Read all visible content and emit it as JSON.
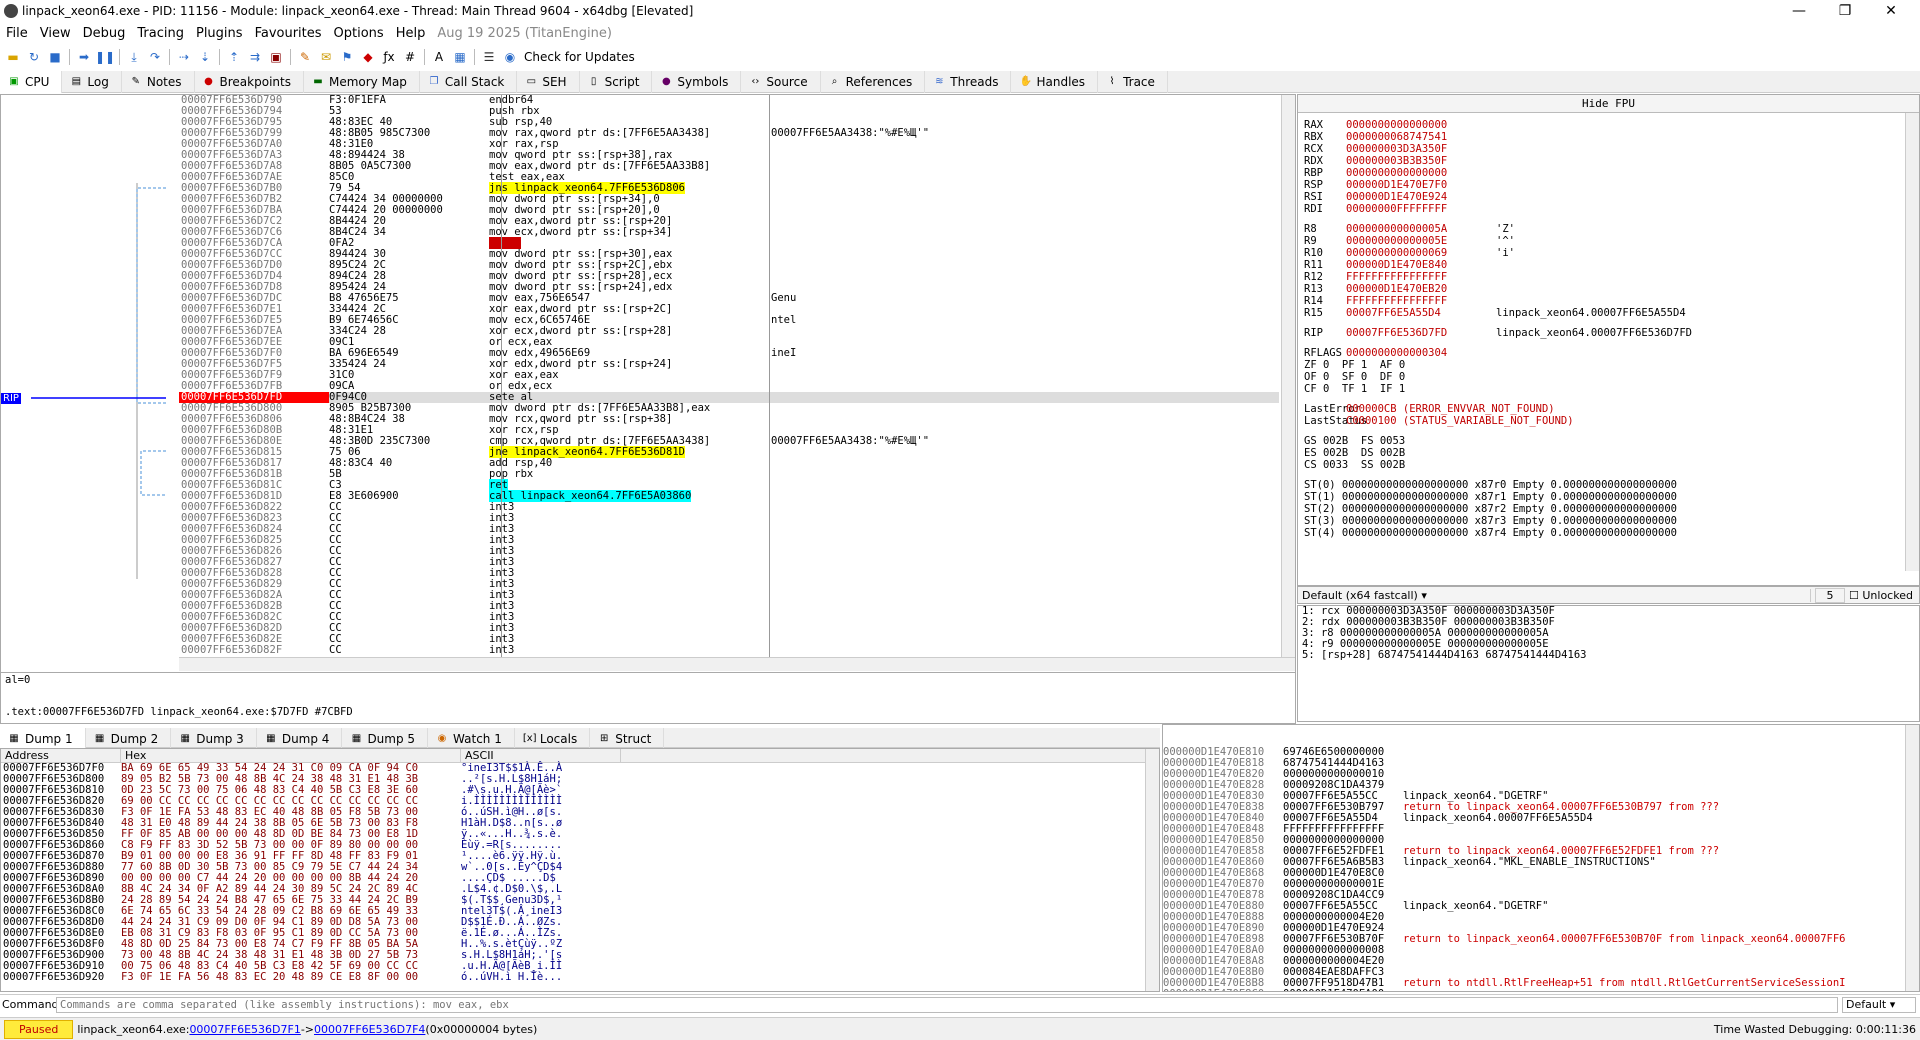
{
  "window": {
    "title": "linpack_xeon64.exe - PID: 11156 - Module: linpack_xeon64.exe - Thread: Main Thread 9604 - x64dbg [Elevated]",
    "minimize": "—",
    "maximize": "❐",
    "close": "✕"
  },
  "menu": {
    "items": [
      "File",
      "View",
      "Debug",
      "Tracing",
      "Plugins",
      "Favourites",
      "Options",
      "Help"
    ],
    "build_info": "Aug 19 2025 (TitanEngine)"
  },
  "toolbar": {
    "check_updates": "Check for Updates",
    "icons": [
      "open-icon",
      "restart-icon",
      "close-icon",
      "run-icon",
      "pause-icon",
      "step-into-icon",
      "step-over-icon",
      "trace-into-icon",
      "trace-over-icon",
      "execute-till-return-icon",
      "run-to-user-code-icon",
      "scylla-icon",
      "patch-icon",
      "comment-icon",
      "label-icon",
      "bookmark-icon",
      "function-icon",
      "hash-icon",
      "font-icon",
      "calculator-icon",
      "checklist-icon",
      "update-icon"
    ]
  },
  "tabs": [
    "CPU",
    "Log",
    "Notes",
    "Breakpoints",
    "Memory Map",
    "Call Stack",
    "SEH",
    "Script",
    "Symbols",
    "Source",
    "References",
    "Threads",
    "Handles",
    "Trace"
  ],
  "disasm": {
    "rows": [
      {
        "addr": "00007FF6E536D790",
        "bytes": "F3:0F1EFA",
        "instr": "endbr64",
        "cmt": ""
      },
      {
        "addr": "00007FF6E536D794",
        "bytes": "53",
        "instr": "push rbx",
        "cmt": ""
      },
      {
        "addr": "00007FF6E536D795",
        "bytes": "48:83EC 40",
        "instr": "sub rsp,40",
        "cmt": ""
      },
      {
        "addr": "00007FF6E536D799",
        "bytes": "48:8B05 985C7300",
        "instr": "mov rax,qword ptr ds:[7FF6E5AA3438]",
        "cmt": "00007FF6E5AA3438:\"%#E%Щ'\""
      },
      {
        "addr": "00007FF6E536D7A0",
        "bytes": "48:31E0",
        "instr": "xor rax,rsp",
        "cmt": ""
      },
      {
        "addr": "00007FF6E536D7A3",
        "bytes": "48:894424 38",
        "instr": "mov qword ptr ss:[rsp+38],rax",
        "cmt": ""
      },
      {
        "addr": "00007FF6E536D7A8",
        "bytes": "8B05 0A5C7300",
        "instr": "mov eax,dword ptr ds:[7FF6E5AA33B8]",
        "cmt": ""
      },
      {
        "addr": "00007FF6E536D7AE",
        "bytes": "85C0",
        "instr": "test eax,eax",
        "cmt": ""
      },
      {
        "addr": "00007FF6E536D7B0",
        "bytes": "79 54",
        "instr": "jns linpack_xeon64.7FF6E536D806",
        "cmt": ""
      },
      {
        "addr": "00007FF6E536D7B2",
        "bytes": "C74424 34 00000000",
        "instr": "mov dword ptr ss:[rsp+34],0",
        "cmt": ""
      },
      {
        "addr": "00007FF6E536D7BA",
        "bytes": "C74424 20 00000000",
        "instr": "mov dword ptr ss:[rsp+20],0",
        "cmt": ""
      },
      {
        "addr": "00007FF6E536D7C2",
        "bytes": "8B4424 20",
        "instr": "mov eax,dword ptr ss:[rsp+20]",
        "cmt": ""
      },
      {
        "addr": "00007FF6E536D7C6",
        "bytes": "8B4C24 34",
        "instr": "mov ecx,dword ptr ss:[rsp+34]",
        "cmt": ""
      },
      {
        "addr": "00007FF6E536D7CA",
        "bytes": "0FA2",
        "instr": "cpuid",
        "cmt": ""
      },
      {
        "addr": "00007FF6E536D7CC",
        "bytes": "894424 30",
        "instr": "mov dword ptr ss:[rsp+30],eax",
        "cmt": ""
      },
      {
        "addr": "00007FF6E536D7D0",
        "bytes": "895C24 2C",
        "instr": "mov dword ptr ss:[rsp+2C],ebx",
        "cmt": ""
      },
      {
        "addr": "00007FF6E536D7D4",
        "bytes": "894C24 28",
        "instr": "mov dword ptr ss:[rsp+28],ecx",
        "cmt": ""
      },
      {
        "addr": "00007FF6E536D7D8",
        "bytes": "895424 24",
        "instr": "mov dword ptr ss:[rsp+24],edx",
        "cmt": ""
      },
      {
        "addr": "00007FF6E536D7DC",
        "bytes": "B8 47656E75",
        "instr": "mov eax,756E6547",
        "cmt": "Genu"
      },
      {
        "addr": "00007FF6E536D7E1",
        "bytes": "334424 2C",
        "instr": "xor eax,dword ptr ss:[rsp+2C]",
        "cmt": ""
      },
      {
        "addr": "00007FF6E536D7E5",
        "bytes": "B9 6E74656C",
        "instr": "mov ecx,6C65746E",
        "cmt": "ntel"
      },
      {
        "addr": "00007FF6E536D7EA",
        "bytes": "334C24 28",
        "instr": "xor ecx,dword ptr ss:[rsp+28]",
        "cmt": ""
      },
      {
        "addr": "00007FF6E536D7EE",
        "bytes": "09C1",
        "instr": "or ecx,eax",
        "cmt": ""
      },
      {
        "addr": "00007FF6E536D7F0",
        "bytes": "BA 696E6549",
        "instr": "mov edx,49656E69",
        "cmt": "ineI"
      },
      {
        "addr": "00007FF6E536D7F5",
        "bytes": "335424 24",
        "instr": "xor edx,dword ptr ss:[rsp+24]",
        "cmt": ""
      },
      {
        "addr": "00007FF6E536D7F9",
        "bytes": "31C0",
        "instr": "xor eax,eax",
        "cmt": ""
      },
      {
        "addr": "00007FF6E536D7FB",
        "bytes": "09CA",
        "instr": "or edx,ecx",
        "cmt": ""
      },
      {
        "addr": "00007FF6E536D7FD",
        "bytes": "0F94C0",
        "instr": "sete al",
        "cmt": ""
      },
      {
        "addr": "00007FF6E536D800",
        "bytes": "8905 B25B7300",
        "instr": "mov dword ptr ds:[7FF6E5AA33B8],eax",
        "cmt": ""
      },
      {
        "addr": "00007FF6E536D806",
        "bytes": "48:8B4C24 38",
        "instr": "mov rcx,qword ptr ss:[rsp+38]",
        "cmt": ""
      },
      {
        "addr": "00007FF6E536D80B",
        "bytes": "48:31E1",
        "instr": "xor rcx,rsp",
        "cmt": ""
      },
      {
        "addr": "00007FF6E536D80E",
        "bytes": "48:3B0D 235C7300",
        "instr": "cmp rcx,qword ptr ds:[7FF6E5AA3438]",
        "cmt": "00007FF6E5AA3438:\"%#E%Щ'\""
      },
      {
        "addr": "00007FF6E536D815",
        "bytes": "75 06",
        "instr": "jne linpack_xeon64.7FF6E536D81D",
        "cmt": ""
      },
      {
        "addr": "00007FF6E536D817",
        "bytes": "48:83C4 40",
        "instr": "add rsp,40",
        "cmt": ""
      },
      {
        "addr": "00007FF6E536D81B",
        "bytes": "5B",
        "instr": "pop rbx",
        "cmt": ""
      },
      {
        "addr": "00007FF6E536D81C",
        "bytes": "C3",
        "instr": "ret",
        "cmt": ""
      },
      {
        "addr": "00007FF6E536D81D",
        "bytes": "E8 3E606900",
        "instr": "call linpack_xeon64.7FF6E5A03860",
        "cmt": ""
      },
      {
        "addr": "00007FF6E536D822",
        "bytes": "CC",
        "instr": "int3",
        "cmt": ""
      },
      {
        "addr": "00007FF6E536D823",
        "bytes": "CC",
        "instr": "int3",
        "cmt": ""
      },
      {
        "addr": "00007FF6E536D824",
        "bytes": "CC",
        "instr": "int3",
        "cmt": ""
      },
      {
        "addr": "00007FF6E536D825",
        "bytes": "CC",
        "instr": "int3",
        "cmt": ""
      },
      {
        "addr": "00007FF6E536D826",
        "bytes": "CC",
        "instr": "int3",
        "cmt": ""
      },
      {
        "addr": "00007FF6E536D827",
        "bytes": "CC",
        "instr": "int3",
        "cmt": ""
      },
      {
        "addr": "00007FF6E536D828",
        "bytes": "CC",
        "instr": "int3",
        "cmt": ""
      },
      {
        "addr": "00007FF6E536D829",
        "bytes": "CC",
        "instr": "int3",
        "cmt": ""
      },
      {
        "addr": "00007FF6E536D82A",
        "bytes": "CC",
        "instr": "int3",
        "cmt": ""
      },
      {
        "addr": "00007FF6E536D82B",
        "bytes": "CC",
        "instr": "int3",
        "cmt": ""
      },
      {
        "addr": "00007FF6E536D82C",
        "bytes": "CC",
        "instr": "int3",
        "cmt": ""
      },
      {
        "addr": "00007FF6E536D82D",
        "bytes": "CC",
        "instr": "int3",
        "cmt": ""
      },
      {
        "addr": "00007FF6E536D82E",
        "bytes": "CC",
        "instr": "int3",
        "cmt": ""
      },
      {
        "addr": "00007FF6E536D82F",
        "bytes": "CC",
        "instr": "int3",
        "cmt": ""
      }
    ],
    "rip_label": "RIP",
    "rip_index": 27
  },
  "info": {
    "line1": "al=0",
    "line2": ".text:00007FF6E536D7FD linpack_xeon64.exe:$7D7FD #7CBFD"
  },
  "registers": {
    "hide_fpu": "Hide FPU",
    "gp": [
      {
        "n": "RAX",
        "v": "0000000000000000",
        "c": ""
      },
      {
        "n": "RBX",
        "v": "0000000068747541",
        "c": ""
      },
      {
        "n": "RCX",
        "v": "000000003D3A350F",
        "c": ""
      },
      {
        "n": "RDX",
        "v": "000000003B3B350F",
        "c": ""
      },
      {
        "n": "RBP",
        "v": "0000000000000000",
        "c": ""
      },
      {
        "n": "RSP",
        "v": "000000D1E470E7F0",
        "c": ""
      },
      {
        "n": "RSI",
        "v": "000000D1E470E924",
        "c": ""
      },
      {
        "n": "RDI",
        "v": "00000000FFFFFFFF",
        "c": ""
      }
    ],
    "ext": [
      {
        "n": "R8",
        "v": "000000000000005A",
        "c": "'Z'"
      },
      {
        "n": "R9",
        "v": "000000000000005E",
        "c": "'^'"
      },
      {
        "n": "R10",
        "v": "0000000000000069",
        "c": "'i'"
      },
      {
        "n": "R11",
        "v": "000000D1E470E840",
        "c": ""
      },
      {
        "n": "R12",
        "v": "FFFFFFFFFFFFFFFF",
        "c": ""
      },
      {
        "n": "R13",
        "v": "000000D1E470EB20",
        "c": ""
      },
      {
        "n": "R14",
        "v": "FFFFFFFFFFFFFFFF",
        "c": ""
      },
      {
        "n": "R15",
        "v": "00007FF6E5A55D4",
        "c": "linpack_xeon64.00007FF6E5A55D4"
      }
    ],
    "rip": {
      "n": "RIP",
      "v": "00007FF6E536D7FD",
      "c": "linpack_xeon64.00007FF6E536D7FD"
    },
    "rflags": {
      "n": "RFLAGS",
      "v": "0000000000000304"
    },
    "flags": [
      "ZF 0  PF 1  AF 0",
      "OF 0  SF 0  DF 0",
      "CF 0  TF 1  IF 1"
    ],
    "lasterror": {
      "n": "LastError",
      "v": "000000CB (ERROR_ENVVAR_NOT_FOUND)"
    },
    "laststatus": {
      "n": "LastStatus",
      "v": "C0000100 (STATUS_VARIABLE_NOT_FOUND)"
    },
    "segs": [
      "GS 002B  FS 0053",
      "ES 002B  DS 002B",
      "CS 0033  SS 002B"
    ],
    "fpu": [
      "ST(0) 00000000000000000000 x87r0 Empty 0.000000000000000000",
      "ST(1) 00000000000000000000 x87r1 Empty 0.000000000000000000",
      "ST(2) 00000000000000000000 x87r2 Empty 0.000000000000000000",
      "ST(3) 00000000000000000000 x87r3 Empty 0.000000000000000000",
      "ST(4) 00000000000000000000 x87r4 Empty 0.000000000000000000"
    ]
  },
  "callconv": {
    "label": "Default (x64 fastcall)",
    "count": "5",
    "unlocked": "Unlocked"
  },
  "args": [
    "1: rcx 000000003D3A350F 000000003D3A350F",
    "2: rdx 000000003B3B350F 000000003B3B350F",
    "3: r8 000000000000005A 000000000000005A",
    "4: r9 000000000000005E 000000000000005E",
    "5: [rsp+28] 68747541444D4163 68747541444D4163"
  ],
  "dumptabs": [
    "Dump 1",
    "Dump 2",
    "Dump 3",
    "Dump 4",
    "Dump 5",
    "Watch 1",
    "Locals",
    "Struct"
  ],
  "dump": {
    "headers": [
      "Address",
      "Hex",
      "ASCII"
    ],
    "rows": [
      {
        "a": "00007FF6E536D7F0",
        "h": "BA 69 6E 65 49 33 54 24 24 31 C0 09 CA 0F 94 C0",
        "s": "°ineI3T$$1À.Ê..À"
      },
      {
        "a": "00007FF6E536D800",
        "h": "89 05 B2 5B 73 00 48 8B 4C 24 38 48 31 E1 48 3B",
        "s": "..²[s.H.L$8H1áH;"
      },
      {
        "a": "00007FF6E536D810",
        "h": "0D 23 5C 73 00 75 06 48 83 C4 40 5B C3 E8 3E 60",
        "s": ".#\\s.u.H.Ä@[Ãè>`"
      },
      {
        "a": "00007FF6E536D820",
        "h": "69 00 CC CC CC CC CC CC CC CC CC CC CC CC CC CC",
        "s": "i.ÌÌÌÌÌÌÌÌÌÌÌÌÌÌ"
      },
      {
        "a": "00007FF6E536D830",
        "h": "F3 0F 1E FA 53 48 83 EC 40 48 8B 05 F8 5B 73 00",
        "s": "ó..úSH.ì@H..ø[s."
      },
      {
        "a": "00007FF6E536D840",
        "h": "48 31 E0 48 89 44 24 38 8B 05 6E 5B 73 00 83 F8",
        "s": "H1àH.D$8..n[s..ø"
      },
      {
        "a": "00007FF6E536D850",
        "h": "FF 0F 85 AB 00 00 00 48 8D 0D BE 84 73 00 E8 1D",
        "s": "ÿ..«...H..¾.s.è."
      },
      {
        "a": "00007FF6E536D860",
        "h": "C8 F9 FF 83 3D 52 5B 73 00 00 0F 89 80 00 00 00",
        "s": "Èùÿ.=R[s........"
      },
      {
        "a": "00007FF6E536D870",
        "h": "B9 01 00 00 00 E8 36 91 FF FF 8D 48 FF 83 F9 01",
        "s": "¹....è6.ÿÿ.Hÿ.ù."
      },
      {
        "a": "00007FF6E536D880",
        "h": "77 60 8B 0D 30 5B 73 00 85 C9 79 5E C7 44 24 34",
        "s": "w`..0[s..Éy^ÇD$4"
      },
      {
        "a": "00007FF6E536D890",
        "h": "00 00 00 00 C7 44 24 20 00 00 00 00 8B 44 24 20",
        "s": "....ÇD$ .....D$ "
      },
      {
        "a": "00007FF6E536D8A0",
        "h": "8B 4C 24 34 0F A2 89 44 24 30 89 5C 24 2C 89 4C",
        "s": ".L$4.¢.D$0.\\$,.L"
      },
      {
        "a": "00007FF6E536D8B0",
        "h": "24 28 89 54 24 24 B8 47 65 6E 75 33 44 24 2C B9",
        "s": "$(.T$$¸Genu3D$,¹"
      },
      {
        "a": "00007FF6E536D8C0",
        "h": "6E 74 65 6C 33 54 24 28 09 C2 B8 69 6E 65 49 33",
        "s": "ntel3T$(.Â¸ineI3"
      },
      {
        "a": "00007FF6E536D8D0",
        "h": "44 24 24 31 C9 09 D0 0F 94 C1 89 0D D8 5A 73 00",
        "s": "D$$1É.Ð..Á..ØZs."
      },
      {
        "a": "00007FF6E536D8E0",
        "h": "EB 08 31 C9 83 F8 03 0F 95 C1 89 0D CC 5A 73 00",
        "s": "ë.1É.ø...Á..ÌZs."
      },
      {
        "a": "00007FF6E536D8F0",
        "h": "48 8D 0D 25 84 73 00 E8 74 C7 F9 FF 8B 05 BA 5A",
        "s": "H..%.s.ètÇùÿ..ºZ"
      },
      {
        "a": "00007FF6E536D900",
        "h": "73 00 48 8B 4C 24 38 48 31 E1 48 3B 0D 27 5B 73",
        "s": "s.H.L$8H1áH;.'[s"
      },
      {
        "a": "00007FF6E536D910",
        "h": "00 75 06 48 83 C4 40 5B C3 E8 42 5F 69 00 CC CC",
        "s": ".u.H.Ä@[ÃèB_i.ÌÌ"
      },
      {
        "a": "00007FF6E536D920",
        "h": "F3 0F 1E FA 56 48 83 EC 20 48 89 CE E8 8F 00 00",
        "s": "ó..úVH.ì H.Îè..."
      }
    ]
  },
  "stack": [
    {
      "a": "000000D1E470E810",
      "v": "69746E6500000000",
      "c": "",
      "r": false
    },
    {
      "a": "000000D1E470E818",
      "v": "68747541444D4163",
      "c": "",
      "r": false
    },
    {
      "a": "000000D1E470E820",
      "v": "0000000000000010",
      "c": "",
      "r": false
    },
    {
      "a": "000000D1E470E828",
      "v": "00009208C1DA4379",
      "c": "",
      "r": false
    },
    {
      "a": "000000D1E470E830",
      "v": "00007FF6E5A55CC",
      "c": "linpack_xeon64.\"DGETRF\"",
      "r": false
    },
    {
      "a": "000000D1E470E838",
      "v": "00007FF6E530B797",
      "c": "return to linpack_xeon64.00007FF6E530B797 from ???",
      "r": true
    },
    {
      "a": "000000D1E470E840",
      "v": "00007FF6E5A55D4",
      "c": "linpack_xeon64.00007FF6E5A55D4",
      "r": false
    },
    {
      "a": "000000D1E470E848",
      "v": "FFFFFFFFFFFFFFFF",
      "c": "",
      "r": false
    },
    {
      "a": "000000D1E470E850",
      "v": "0000000000000000",
      "c": "",
      "r": false
    },
    {
      "a": "000000D1E470E858",
      "v": "00007FF6E52FDFE1",
      "c": "return to linpack_xeon64.00007FF6E52FDFE1 from ???",
      "r": true
    },
    {
      "a": "000000D1E470E860",
      "v": "00007FF6E5A6B5B3",
      "c": "linpack_xeon64.\"MKL_ENABLE_INSTRUCTIONS\"",
      "r": false
    },
    {
      "a": "000000D1E470E868",
      "v": "000000D1E470E8C0",
      "c": "",
      "r": false
    },
    {
      "a": "000000D1E470E870",
      "v": "000000000000001E",
      "c": "",
      "r": false
    },
    {
      "a": "000000D1E470E878",
      "v": "00009208C1DA4CC9",
      "c": "",
      "r": false
    },
    {
      "a": "000000D1E470E880",
      "v": "00007FF6E5A55CC",
      "c": "linpack_xeon64.\"DGETRF\"",
      "r": false
    },
    {
      "a": "000000D1E470E888",
      "v": "0000000000004E20",
      "c": "",
      "r": false
    },
    {
      "a": "000000D1E470E890",
      "v": "000000D1E470E924",
      "c": "",
      "r": false
    },
    {
      "a": "000000D1E470E898",
      "v": "00007FF6E530B70F",
      "c": "return to linpack_xeon64.00007FF6E530B70F from linpack_xeon64.00007FF6",
      "r": true
    },
    {
      "a": "000000D1E470E8A0",
      "v": "0000000000000008",
      "c": "",
      "r": false
    },
    {
      "a": "000000D1E470E8A8",
      "v": "0000000000004E20",
      "c": "",
      "r": false
    },
    {
      "a": "000000D1E470E8B0",
      "v": "000084EAE8DAFFC3",
      "c": "",
      "r": false
    },
    {
      "a": "000000D1E470E8B8",
      "v": "00007FF9518D47B1",
      "c": "return to ntdll.RtlFreeHeap+51 from ntdll.RtlGetCurrentServiceSessionI",
      "r": true
    },
    {
      "a": "000000D1E470E8C0",
      "v": "000000D1E470EA00",
      "c": "",
      "r": false
    }
  ],
  "command": {
    "label": "Command:",
    "placeholder": "Commands are comma separated (like assembly instructions): mov eax, ebx",
    "mode": "Default"
  },
  "status": {
    "state": "Paused",
    "prefix": "linpack_xeon64.exe: ",
    "from": "00007FF6E536D7F1",
    "arrow": " -> ",
    "to": "00007FF6E536D7F4",
    "suffix": " (0x00000004 bytes)",
    "time": "Time Wasted Debugging: 0:00:11:36"
  }
}
